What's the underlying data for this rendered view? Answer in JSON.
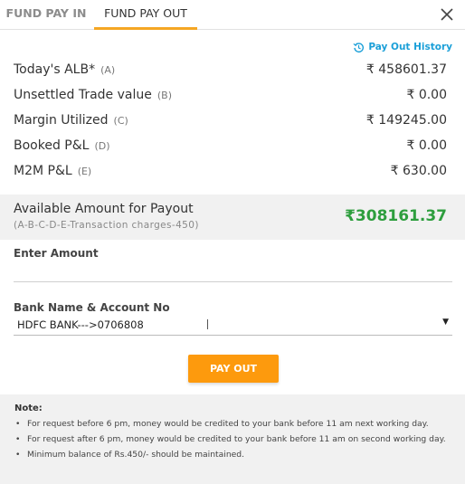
{
  "tabs": {
    "fund_pay_in": "FUND PAY IN",
    "fund_pay_out": "FUND PAY OUT",
    "active": "FUND PAY OUT"
  },
  "header": {
    "payout_history_label": "Pay Out History"
  },
  "summary": [
    {
      "label": "Today's ALB*",
      "code": "(A)",
      "value": "₹ 458601.37"
    },
    {
      "label": "Unsettled Trade value",
      "code": "(B)",
      "value": "₹ 0.00"
    },
    {
      "label": "Margin Utilized",
      "code": "(C)",
      "value": "₹ 149245.00"
    },
    {
      "label": "Booked P&L",
      "code": "(D)",
      "value": "₹ 0.00"
    },
    {
      "label": "M2M P&L",
      "code": "(E)",
      "value": "₹ 630.00"
    }
  ],
  "available": {
    "title": "Available Amount for Payout",
    "formula": "(A-B-C-D-E-Transaction charges-450)",
    "amount": "₹308161.37"
  },
  "form": {
    "amount_label": "Enter Amount",
    "amount_value": "",
    "bank_label": "Bank Name & Account No",
    "bank_value": "HDFC BANK--->0706808",
    "payout_button": "PAY OUT"
  },
  "notes": {
    "title": "Note:",
    "items": [
      "For request before 6 pm, money would be credited to your bank before 11 am next working day.",
      "For request after 6 pm, money would be credited to your bank before 11 am on second working day.",
      "Minimum balance of Rs.450/- should be maintained."
    ]
  },
  "colors": {
    "accent": "#f5a623",
    "button": "#fd9a0d",
    "link": "#1a9fd8",
    "available_amount": "#2e9e3e",
    "panel_bg": "#f1f1f1"
  },
  "icons": {
    "close": "close-icon",
    "history": "history-icon",
    "dropdown": "chevron-down-icon"
  }
}
